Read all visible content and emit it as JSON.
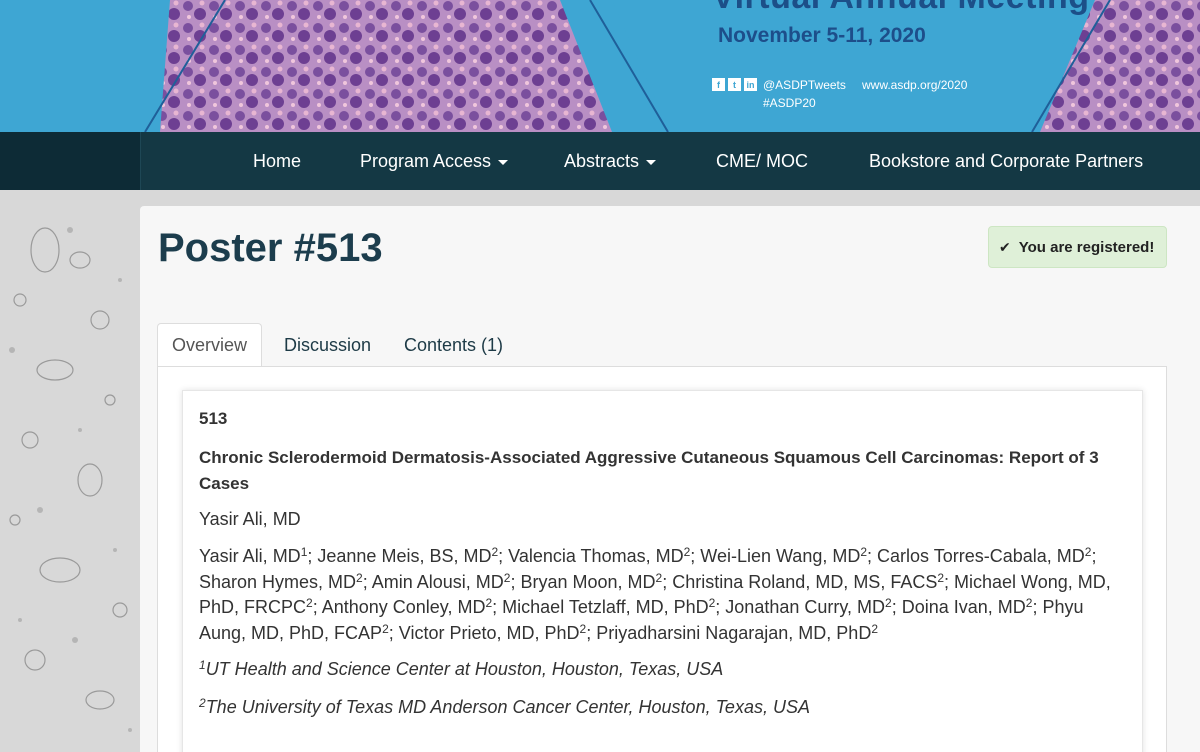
{
  "banner": {
    "title_partial": "Virtual Annual Meeting",
    "dates": "November 5-11, 2020",
    "social_icons": [
      "facebook-icon",
      "twitter-icon",
      "linkedin-icon"
    ],
    "handle": "@ASDPTweets",
    "hashtag": "#ASDP20",
    "url": "www.asdp.org/2020",
    "colors": {
      "background": "#3ea6d3",
      "dark_text": "#1d4e8a",
      "histology": "#9b6fb3"
    }
  },
  "nav": {
    "items": [
      {
        "label": "Home",
        "dropdown": false
      },
      {
        "label": "Program Access",
        "dropdown": true
      },
      {
        "label": "Abstracts",
        "dropdown": true
      },
      {
        "label": "CME/ MOC",
        "dropdown": false
      },
      {
        "label": "Bookstore and Corporate Partners",
        "dropdown": false
      }
    ],
    "colors": {
      "background": "#143844"
    }
  },
  "page": {
    "title": "Poster #513",
    "registered_badge": "You are registered!"
  },
  "tabs": [
    {
      "label": "Overview",
      "active": true
    },
    {
      "label": "Discussion",
      "active": false
    },
    {
      "label": "Contents (1)",
      "active": false
    }
  ],
  "abstract": {
    "number": "513",
    "title": "Chronic Sclerodermoid Dermatosis-Associated Aggressive Cutaneous Squamous Cell Carcinomas: Report of 3 Cases",
    "presenter": "Yasir Ali, MD",
    "authors": [
      {
        "name": "Yasir Ali, MD",
        "aff": "1"
      },
      {
        "name": "Jeanne Meis, BS, MD",
        "aff": "2"
      },
      {
        "name": "Valencia Thomas, MD",
        "aff": "2"
      },
      {
        "name": "Wei-Lien Wang, MD",
        "aff": "2"
      },
      {
        "name": "Carlos Torres-Cabala, MD",
        "aff": "2"
      },
      {
        "name": "Sharon Hymes, MD",
        "aff": "2"
      },
      {
        "name": "Amin Alousi, MD",
        "aff": "2"
      },
      {
        "name": "Bryan Moon, MD",
        "aff": "2"
      },
      {
        "name": "Christina Roland, MD, MS, FACS",
        "aff": "2"
      },
      {
        "name": "Michael Wong, MD, PhD, FRCPC",
        "aff": "2"
      },
      {
        "name": "Anthony Conley, MD",
        "aff": "2"
      },
      {
        "name": "Michael Tetzlaff, MD, PhD",
        "aff": "2"
      },
      {
        "name": "Jonathan Curry, MD",
        "aff": "2"
      },
      {
        "name": "Doina Ivan, MD",
        "aff": "2"
      },
      {
        "name": "Phyu Aung, MD, PhD, FCAP",
        "aff": "2"
      },
      {
        "name": "Victor Prieto, MD, PhD",
        "aff": "2"
      },
      {
        "name": "Priyadharsini Nagarajan, MD, PhD",
        "aff": "2"
      }
    ],
    "affiliations": [
      {
        "num": "1",
        "text": "UT Health and Science Center at Houston, Houston, Texas, USA"
      },
      {
        "num": "2",
        "text": "The University of Texas MD Anderson Cancer Center, Houston, Texas, USA"
      }
    ]
  }
}
